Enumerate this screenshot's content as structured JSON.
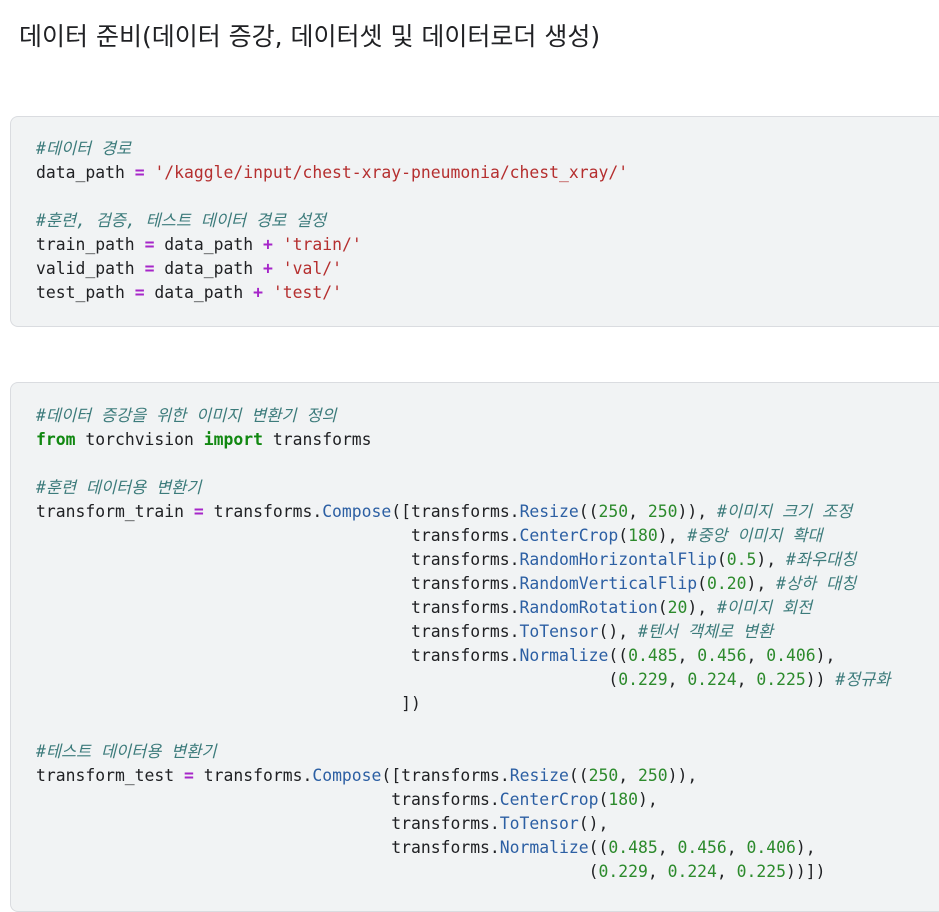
{
  "heading": "데이터 준비(데이터 증강, 데이터셋 및 데이터로더 생성)",
  "cell1": {
    "lines": [
      [
        {
          "t": "#데이터 경로",
          "c": "c"
        }
      ],
      [
        {
          "t": "data_path "
        },
        {
          "t": "=",
          "c": "op"
        },
        {
          "t": " "
        },
        {
          "t": "'/kaggle/input/chest-xray-pneumonia/chest_xray/'",
          "c": "s"
        }
      ],
      [],
      [
        {
          "t": "#훈련, 검증, 테스트 데이터 경로 설정",
          "c": "c"
        }
      ],
      [
        {
          "t": "train_path "
        },
        {
          "t": "=",
          "c": "op"
        },
        {
          "t": " data_path "
        },
        {
          "t": "+",
          "c": "op"
        },
        {
          "t": " "
        },
        {
          "t": "'train/'",
          "c": "s"
        }
      ],
      [
        {
          "t": "valid_path "
        },
        {
          "t": "=",
          "c": "op"
        },
        {
          "t": " data_path "
        },
        {
          "t": "+",
          "c": "op"
        },
        {
          "t": " "
        },
        {
          "t": "'val/'",
          "c": "s"
        }
      ],
      [
        {
          "t": "test_path "
        },
        {
          "t": "=",
          "c": "op"
        },
        {
          "t": " data_path "
        },
        {
          "t": "+",
          "c": "op"
        },
        {
          "t": " "
        },
        {
          "t": "'test/'",
          "c": "s"
        }
      ]
    ]
  },
  "cell2": {
    "lines": [
      [
        {
          "t": "#데이터 증강을 위한 이미지 변환기 정의",
          "c": "c"
        }
      ],
      [
        {
          "t": "from",
          "c": "kw"
        },
        {
          "t": " torchvision "
        },
        {
          "t": "import",
          "c": "kw"
        },
        {
          "t": " transforms"
        }
      ],
      [],
      [
        {
          "t": "#훈련 데이터용 변환기",
          "c": "c"
        }
      ],
      [
        {
          "t": "transform_train "
        },
        {
          "t": "=",
          "c": "op"
        },
        {
          "t": " transforms."
        },
        {
          "t": "Compose",
          "c": "fn"
        },
        {
          "t": "([transforms."
        },
        {
          "t": "Resize",
          "c": "fn"
        },
        {
          "t": "(("
        },
        {
          "t": "250",
          "c": "nm"
        },
        {
          "t": ", "
        },
        {
          "t": "250",
          "c": "nm"
        },
        {
          "t": ")), "
        },
        {
          "t": "#이미지 크기 조정",
          "c": "c"
        }
      ],
      [
        {
          "t": "                                      transforms."
        },
        {
          "t": "CenterCrop",
          "c": "fn"
        },
        {
          "t": "("
        },
        {
          "t": "180",
          "c": "nm"
        },
        {
          "t": "), "
        },
        {
          "t": "#중앙 이미지 확대",
          "c": "c"
        }
      ],
      [
        {
          "t": "                                      transforms."
        },
        {
          "t": "RandomHorizontalFlip",
          "c": "fn"
        },
        {
          "t": "("
        },
        {
          "t": "0.5",
          "c": "nm"
        },
        {
          "t": "), "
        },
        {
          "t": "#좌우대칭",
          "c": "c"
        }
      ],
      [
        {
          "t": "                                      transforms."
        },
        {
          "t": "RandomVerticalFlip",
          "c": "fn"
        },
        {
          "t": "("
        },
        {
          "t": "0.20",
          "c": "nm"
        },
        {
          "t": "), "
        },
        {
          "t": "#상하 대칭",
          "c": "c"
        }
      ],
      [
        {
          "t": "                                      transforms."
        },
        {
          "t": "RandomRotation",
          "c": "fn"
        },
        {
          "t": "("
        },
        {
          "t": "20",
          "c": "nm"
        },
        {
          "t": "), "
        },
        {
          "t": "#이미지 회전",
          "c": "c"
        }
      ],
      [
        {
          "t": "                                      transforms."
        },
        {
          "t": "ToTensor",
          "c": "fn"
        },
        {
          "t": "(), "
        },
        {
          "t": "#텐서 객체로 변환",
          "c": "c"
        }
      ],
      [
        {
          "t": "                                      transforms."
        },
        {
          "t": "Normalize",
          "c": "fn"
        },
        {
          "t": "(("
        },
        {
          "t": "0.485",
          "c": "nm"
        },
        {
          "t": ", "
        },
        {
          "t": "0.456",
          "c": "nm"
        },
        {
          "t": ", "
        },
        {
          "t": "0.406",
          "c": "nm"
        },
        {
          "t": "),"
        }
      ],
      [
        {
          "t": "                                                          ("
        },
        {
          "t": "0.229",
          "c": "nm"
        },
        {
          "t": ", "
        },
        {
          "t": "0.224",
          "c": "nm"
        },
        {
          "t": ", "
        },
        {
          "t": "0.225",
          "c": "nm"
        },
        {
          "t": ")) "
        },
        {
          "t": "#정규화",
          "c": "c"
        }
      ],
      [
        {
          "t": "                                     ])"
        }
      ],
      [],
      [
        {
          "t": "#테스트 데이터용 변환기",
          "c": "c"
        }
      ],
      [
        {
          "t": "transform_test "
        },
        {
          "t": "=",
          "c": "op"
        },
        {
          "t": " transforms."
        },
        {
          "t": "Compose",
          "c": "fn"
        },
        {
          "t": "([transforms."
        },
        {
          "t": "Resize",
          "c": "fn"
        },
        {
          "t": "(("
        },
        {
          "t": "250",
          "c": "nm"
        },
        {
          "t": ", "
        },
        {
          "t": "250",
          "c": "nm"
        },
        {
          "t": ")),"
        }
      ],
      [
        {
          "t": "                                    transforms."
        },
        {
          "t": "CenterCrop",
          "c": "fn"
        },
        {
          "t": "("
        },
        {
          "t": "180",
          "c": "nm"
        },
        {
          "t": "),"
        }
      ],
      [
        {
          "t": "                                    transforms."
        },
        {
          "t": "ToTensor",
          "c": "fn"
        },
        {
          "t": "(),"
        }
      ],
      [
        {
          "t": "                                    transforms."
        },
        {
          "t": "Normalize",
          "c": "fn"
        },
        {
          "t": "(("
        },
        {
          "t": "0.485",
          "c": "nm"
        },
        {
          "t": ", "
        },
        {
          "t": "0.456",
          "c": "nm"
        },
        {
          "t": ", "
        },
        {
          "t": "0.406",
          "c": "nm"
        },
        {
          "t": "),"
        }
      ],
      [
        {
          "t": "                                                        ("
        },
        {
          "t": "0.229",
          "c": "nm"
        },
        {
          "t": ", "
        },
        {
          "t": "0.224",
          "c": "nm"
        },
        {
          "t": ", "
        },
        {
          "t": "0.225",
          "c": "nm"
        },
        {
          "t": "))])"
        }
      ]
    ]
  }
}
